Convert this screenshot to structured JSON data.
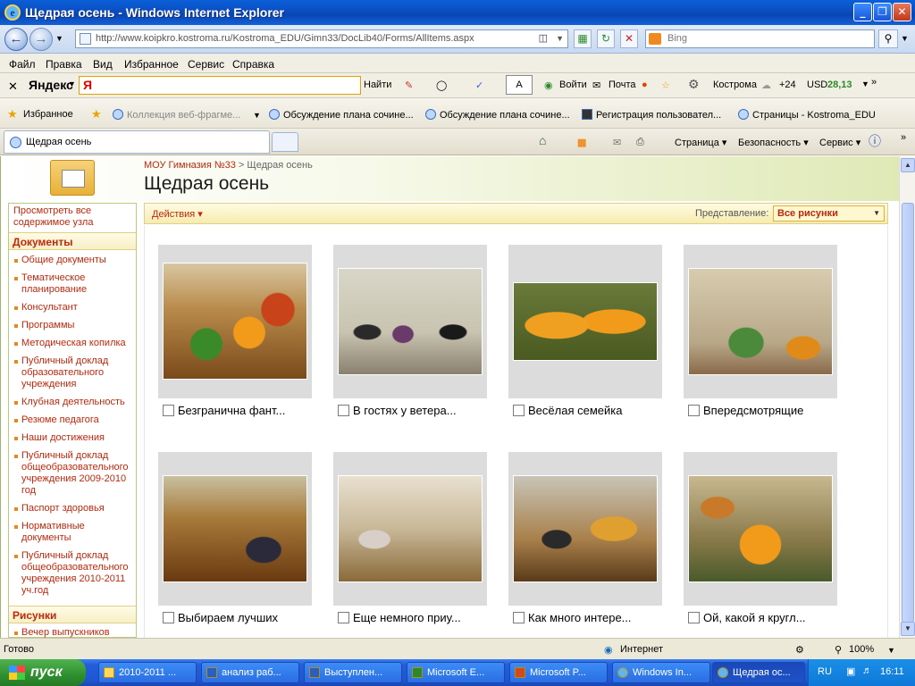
{
  "window": {
    "title": "Щедрая осень - Windows Internet Explorer",
    "min": "_",
    "max": "❐",
    "close": "✕"
  },
  "address": {
    "url": "http://www.koipkro.kostroma.ru/Kostroma_EDU/Gimn33/DocLib40/Forms/AllItems.aspx",
    "search_placeholder": "Bing"
  },
  "menu": [
    "Файл",
    "Правка",
    "Вид",
    "Избранное",
    "Сервис",
    "Справка"
  ],
  "yandex": {
    "logo": "Яндекс",
    "input": "Я",
    "find": "Найти",
    "login": "Войти",
    "mail": "Почта",
    "city": "Кострома",
    "temp": "+24",
    "usd_label": "USD",
    "usd_value": "28,13"
  },
  "favorites": {
    "label": "Избранное",
    "items": [
      "Коллекция веб-фрагме...",
      "Обсуждение плана сочине...",
      "Обсуждение плана сочине...",
      "Регистрация пользовател...",
      "Страницы - Kostroma_EDU"
    ]
  },
  "tab": {
    "title": "Щедрая осень",
    "page": "Страница",
    "security": "Безопасность",
    "service": "Сервис"
  },
  "page": {
    "breadcrumb_root": "МОУ Гимназия №33",
    "breadcrumb_sep": " > ",
    "breadcrumb_current": "Щедрая осень",
    "title": "Щедрая осень"
  },
  "nav": {
    "view_all": "Просмотреть все содержимое узла",
    "documents": "Документы",
    "pictures": "Рисунки",
    "items": [
      "Общие документы",
      "Тематическое планирование",
      "Консультант",
      "Программы",
      "Методическая копилка",
      "Публичный доклад образовательного учреждения",
      "Клубная деятельность",
      "Резюме педагога",
      "Наши достижения",
      "Публичный доклад общеобразовательного учреждения 2009-2010 год",
      "Паспорт здоровья",
      "Нормативные документы",
      "Публичный доклад общеобразовательного учреждения 2010-2011 уч.год"
    ],
    "pic_items": [
      "Вечер выпускников"
    ]
  },
  "toolbar": {
    "actions": "Действия ▾",
    "view_label": "Представление:",
    "view_value": "Все рисунки"
  },
  "gallery": [
    "Безгранична фант...",
    "В гостях у ветера...",
    "Весёлая семейка",
    "Впередсмотрящие",
    "Выбираем лучших",
    "Еще немного приу...",
    "Как много интере...",
    "Ой, какой я кругл..."
  ],
  "status": {
    "left": "Готово",
    "zone": "Интернет",
    "zoom": "100%"
  },
  "taskbar": {
    "start": "пуск",
    "tasks": [
      "2010-2011 ...",
      "анализ раб...",
      "Выступлен...",
      "Microsoft E...",
      "Microsoft P...",
      "Windows In...",
      "Щедрая ос..."
    ],
    "lang": "RU",
    "time": "16:11"
  }
}
